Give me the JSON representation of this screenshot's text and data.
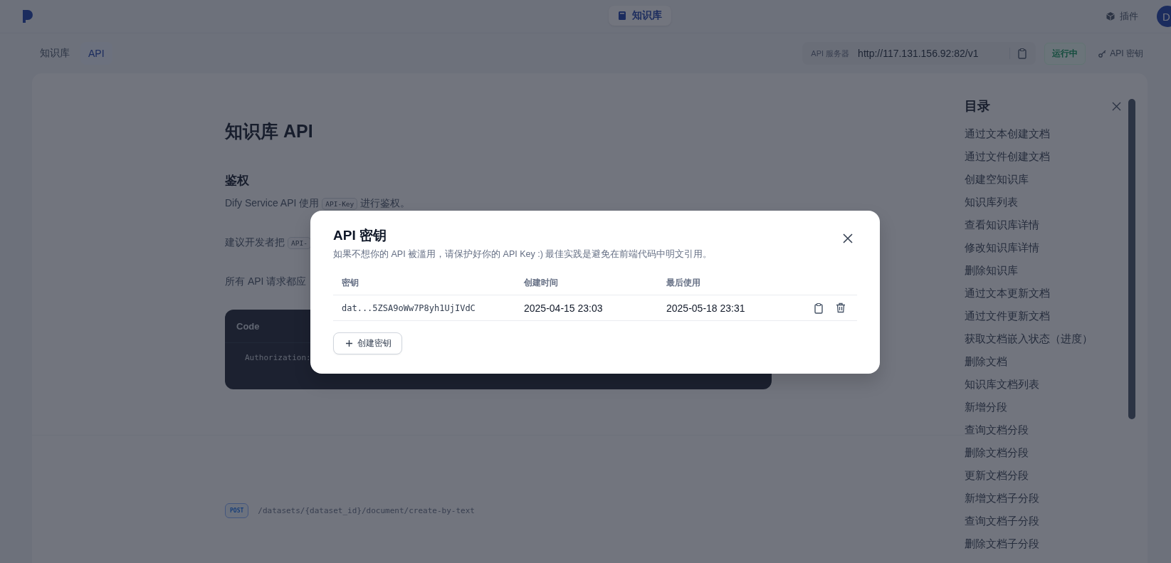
{
  "header": {
    "nav": [
      {
        "label": "知识库",
        "selected": true
      }
    ],
    "plugins_label": "插件",
    "avatar": "D"
  },
  "subnav": {
    "tabs": [
      {
        "label": "知识库",
        "selected": false
      },
      {
        "label": "API",
        "selected": true
      }
    ],
    "server_label": "API 服务器",
    "server_url": "http://117.131.156.92:82/v1",
    "status": {
      "label": "运行中",
      "running": true
    },
    "api_key_button": "API 密钥"
  },
  "doc": {
    "title": "知识库 API",
    "section": "鉴权",
    "paragraphs": [
      {
        "parts": [
          {
            "kind": "text",
            "text": "Dify Service API 使用"
          },
          {
            "kind": "code",
            "text": "API-Key"
          },
          {
            "kind": "text",
            "text": "进行鉴权。"
          }
        ]
      },
      {
        "parts": [
          {
            "kind": "text",
            "text": "建议开发者把"
          },
          {
            "kind": "code",
            "text": "API-"
          }
        ]
      },
      {
        "parts": [
          {
            "kind": "text",
            "text": "所有 API 请求都应"
          }
        ]
      }
    ],
    "code_block": {
      "title": "Code",
      "lines": [
        "Authorization:"
      ]
    },
    "endpoint": {
      "method": "POST",
      "path": "/datasets/{dataset_id}/document/create-by-text"
    }
  },
  "toc": {
    "title": "目录",
    "items": [
      "通过文本创建文档",
      "通过文件创建文档",
      "创建空知识库",
      "知识库列表",
      "查看知识库详情",
      "修改知识库详情",
      "删除知识库",
      "通过文本更新文档",
      "通过文件更新文档",
      "获取文档嵌入状态（进度）",
      "删除文档",
      "知识库文档列表",
      "新增分段",
      "查询文档分段",
      "删除文档分段",
      "更新文档分段",
      "新增文档子分段",
      "查询文档子分段",
      "删除文档子分段"
    ]
  },
  "modal": {
    "title": "API 密钥",
    "description": "如果不想你的 API 被滥用，请保护好你的 API Key :) 最佳实践是避免在前端代码中明文引用。",
    "columns": [
      "密钥",
      "创建时间",
      "最后使用"
    ],
    "rows": [
      {
        "key": "dat...5ZSA9oWw7P8yh1UjIVdC",
        "created": "2025-04-15 23:03",
        "last_used": "2025-05-18 23:31"
      }
    ],
    "create_button": "创建密钥"
  }
}
